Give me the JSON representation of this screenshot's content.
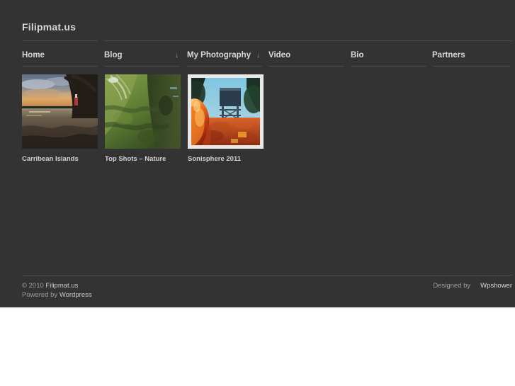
{
  "site": {
    "title": "Filipmat.us",
    "background_color": "#333333",
    "text_color": "#d8d8d8",
    "rule_color": "#4a4a4a"
  },
  "nav": {
    "items": [
      {
        "label": "Home",
        "has_submenu": false
      },
      {
        "label": "Blog",
        "has_submenu": true
      },
      {
        "label": "My Photography",
        "has_submenu": true
      },
      {
        "label": "Video",
        "has_submenu": false
      },
      {
        "label": "Bio",
        "has_submenu": false
      },
      {
        "label": "Partners",
        "has_submenu": false
      }
    ],
    "submenu_arrow": "↓"
  },
  "gallery": {
    "items": [
      {
        "caption": "Carribean Islands",
        "active": false
      },
      {
        "caption": "Top Shots – Nature",
        "active": false
      },
      {
        "caption": "Sonisphere 2011",
        "active": true
      }
    ]
  },
  "footer": {
    "copyright_prefix": "© 2010 ",
    "copyright_link": "Filipmat.us",
    "powered_prefix": "Powered by ",
    "powered_link": "Wordpress",
    "designed_by": "Designed by",
    "designer_link": "Wpshower"
  }
}
